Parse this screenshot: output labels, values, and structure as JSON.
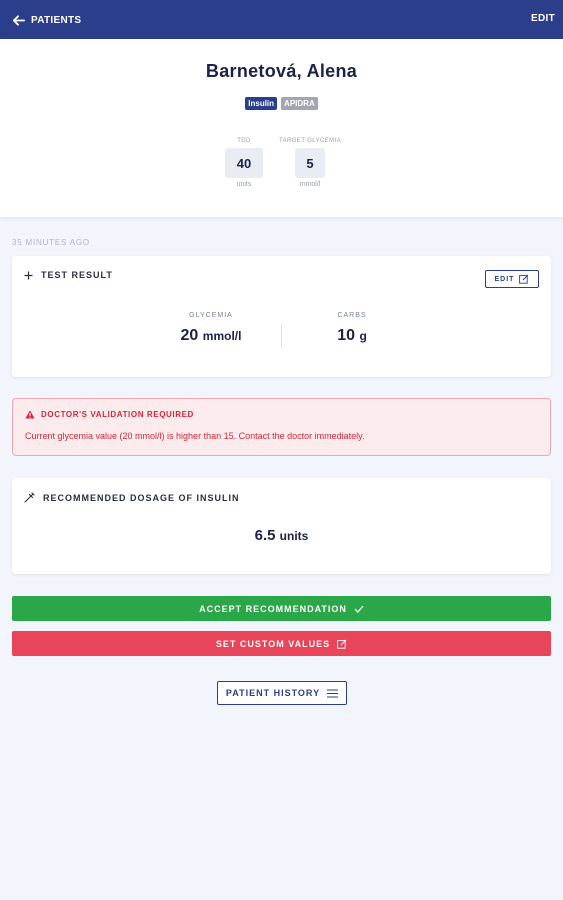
{
  "topbar": {
    "back_label": "PATIENTS",
    "edit_label": "EDIT"
  },
  "patient": {
    "name": "Barnetová, Alena",
    "badges": [
      "Insulin",
      "APIDRA"
    ],
    "tdd": {
      "label": "TDD",
      "value": "40",
      "unit": "units"
    },
    "target": {
      "label": "TARGET GLYCEMIA",
      "value": "5",
      "unit": "mmol/l"
    }
  },
  "timestamp": "35 MINUTES AGO",
  "test_result": {
    "title": "TEST RESULT",
    "edit_label": "EDIT",
    "glycemia": {
      "label": "GLYCEMIA",
      "value": "20",
      "unit": "mmol/l"
    },
    "carbs": {
      "label": "CARBS",
      "value": "10",
      "unit": "g"
    }
  },
  "alert": {
    "title": "DOCTOR'S VALIDATION REQUIRED",
    "message": "Current glycemia value (20 mmol/l) is higher than 15. Contact the doctor immediately."
  },
  "dosage": {
    "title": "RECOMMENDED DOSAGE OF INSULIN",
    "value": "6.5",
    "unit": "units"
  },
  "actions": {
    "accept": "ACCEPT RECOMMENDATION",
    "custom": "SET CUSTOM VALUES",
    "history": "PATIENT HISTORY"
  },
  "colors": {
    "primary": "#2b3e8c",
    "success": "#2aa748",
    "danger": "#e8455a"
  }
}
